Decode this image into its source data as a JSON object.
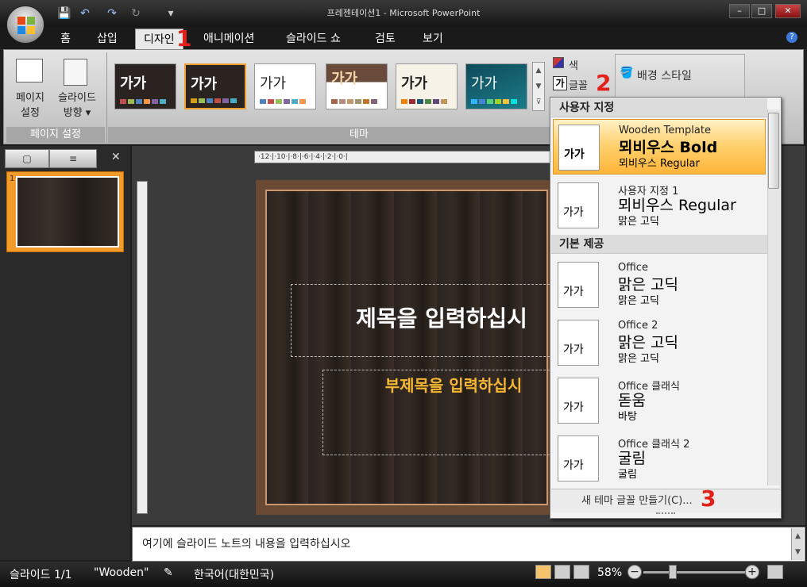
{
  "window": {
    "title": "프레젠테이션1 - Microsoft PowerPoint",
    "min": "–",
    "max": "□",
    "close": "✕"
  },
  "ribbon_tabs": [
    "홈",
    "삽입",
    "디자인",
    "애니메이션",
    "슬라이드 쇼",
    "검토",
    "보기"
  ],
  "active_tab": "디자인",
  "page_setup": {
    "btn1": [
      "페이지",
      "설정"
    ],
    "btn2": [
      "슬라이드",
      "방향 ▾"
    ],
    "group": "페이지 설정"
  },
  "themes_group": {
    "label": "테마",
    "sample": "가가"
  },
  "theme_options": {
    "colors": "색",
    "fonts": "글꼴",
    "background": "배경 스타일"
  },
  "left_pane": {
    "slide_num": "1",
    "close": "✕"
  },
  "ruler": {
    "h": "·12·|·10·|·8·|·6·|·4·|·2·|·0·|"
  },
  "slide": {
    "title": "제목을 입력하십시",
    "subtitle": "부제목을 입력하십시"
  },
  "notes": "여기에 슬라이드 노트의 내용을 입력하십시오",
  "status": {
    "slide": "슬라이드 1/1",
    "theme": "\"Wooden\"",
    "lang": "한국어(대한민국)",
    "zoom": "58%"
  },
  "fonts_dropdown": {
    "custom_header": "사용자 지정",
    "builtin_header": "기본 제공",
    "icon_text": "가가",
    "items": [
      {
        "name": "Wooden Template",
        "major": "뫼비우스 Bold",
        "minor": "뫼비우스 Regular",
        "selected": true
      },
      {
        "name": "사용자 지정 1",
        "major": "뫼비우스 Regular",
        "minor": "맑은 고딕"
      },
      {
        "name": "Office",
        "major": "맑은 고딕",
        "minor": "맑은 고딕"
      },
      {
        "name": "Office 2",
        "major": "맑은 고딕",
        "minor": "맑은 고딕"
      },
      {
        "name": "Office 클래식",
        "major": "돋움",
        "minor": "바탕"
      },
      {
        "name": "Office 클래식 2",
        "major": "굴림",
        "minor": "굴림"
      }
    ],
    "footer": "새 테마 글꼴 만들기(C)..."
  },
  "markers": [
    "1",
    "2",
    "3"
  ],
  "colors": {
    "accent": "#f29a2a",
    "selected": "#ffcf6a",
    "subtitle": "#f7b733",
    "marker": "#e1211a"
  }
}
